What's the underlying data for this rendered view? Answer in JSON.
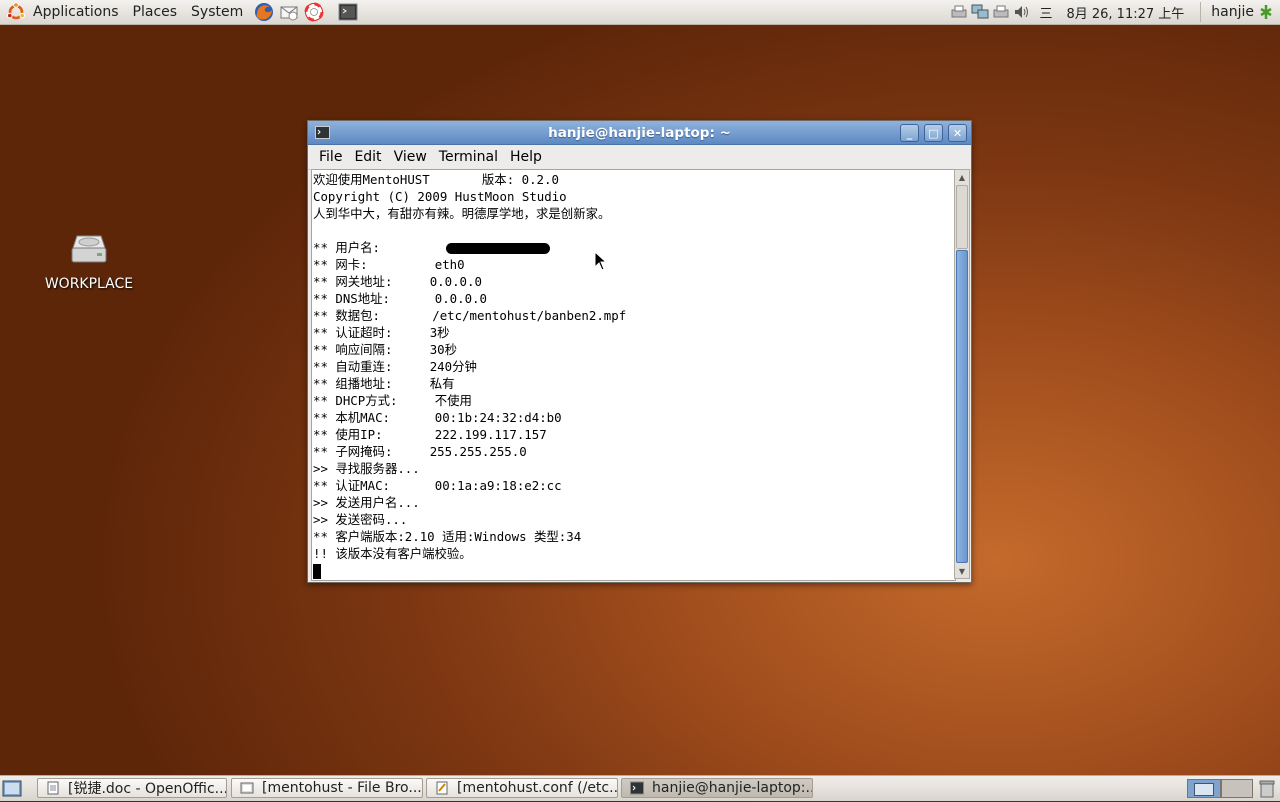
{
  "top_panel": {
    "menus": [
      "Applications",
      "Places",
      "System"
    ],
    "launchers": [
      "firefox-icon",
      "mail-icon",
      "help-icon",
      "terminal-icon"
    ],
    "clock": "8月 26, 11:27 上午",
    "weekday": "三",
    "user": "hanjie"
  },
  "desktop": {
    "icon_label": "WORKPLACE"
  },
  "window": {
    "title": "hanjie@hanjie-laptop: ~",
    "menu": [
      "File",
      "Edit",
      "View",
      "Terminal",
      "Help"
    ],
    "lines": [
      "欢迎使用MentoHUST       版本: 0.2.0",
      "Copyright (C) 2009 HustMoon Studio",
      "人到华中大，有甜亦有辣。明德厚学地，求是创新家。",
      "",
      "** 用户名:",
      "** 网卡:         eth0",
      "** 网关地址:     0.0.0.0",
      "** DNS地址:      0.0.0.0",
      "** 数据包:       /etc/mentohust/banben2.mpf",
      "** 认证超时:     3秒",
      "** 响应间隔:     30秒",
      "** 自动重连:     240分钟",
      "** 组播地址:     私有",
      "** DHCP方式:     不使用",
      "** 本机MAC:      00:1b:24:32:d4:b0",
      "** 使用IP:       222.199.117.157",
      "** 子网掩码:     255.255.255.0",
      ">> 寻找服务器...",
      "** 认证MAC:      00:1a:a9:18:e2:cc",
      ">> 发送用户名...",
      ">> 发送密码...",
      "** 客户端版本:2.10 适用:Windows 类型:34",
      "!! 该版本没有客户端校验。"
    ]
  },
  "taskbar": {
    "tasks": [
      "[锐捷.doc - OpenOffic...",
      "[mentohust - File Bro...",
      "[mentohust.conf (/etc...",
      "hanjie@hanjie-laptop:..."
    ]
  },
  "colors": {
    "title_bar": "#6f97cc",
    "desktop": "#8a3f14",
    "panel": "#e4e0da"
  }
}
